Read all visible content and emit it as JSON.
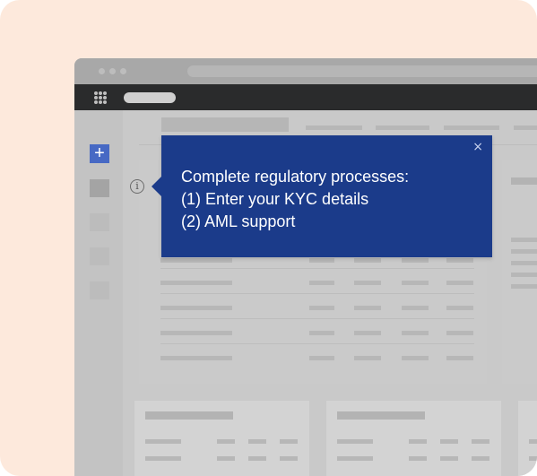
{
  "tooltip": {
    "lines": [
      "Complete regulatory processes:",
      "(1) Enter your KYC details",
      "(2) AML support"
    ],
    "close_icon": "×",
    "background": "#1b3b8a"
  },
  "sidebar": {
    "add_icon": "+",
    "accent": "#4769c4"
  },
  "info_icon": "i",
  "icons": [
    "apps-grid-icon",
    "plus-icon",
    "info-icon",
    "close-icon"
  ]
}
